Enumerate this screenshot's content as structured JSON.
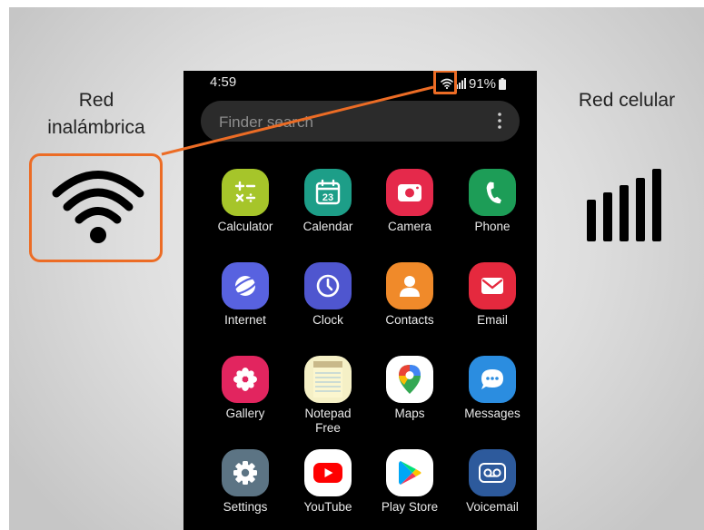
{
  "labels": {
    "wireless": "Red inalámbrica",
    "cellular": "Red celular"
  },
  "status": {
    "time": "4:59",
    "battery": "91%"
  },
  "search": {
    "placeholder": "Finder search"
  },
  "apps": [
    {
      "label": "Calculator",
      "icon": "calculator-icon"
    },
    {
      "label": "Calendar",
      "icon": "calendar-icon",
      "badge": "23"
    },
    {
      "label": "Camera",
      "icon": "camera-icon"
    },
    {
      "label": "Phone",
      "icon": "phone-icon"
    },
    {
      "label": "Internet",
      "icon": "internet-icon"
    },
    {
      "label": "Clock",
      "icon": "clock-icon"
    },
    {
      "label": "Contacts",
      "icon": "contacts-icon"
    },
    {
      "label": "Email",
      "icon": "email-icon"
    },
    {
      "label": "Gallery",
      "icon": "gallery-icon"
    },
    {
      "label": "Notepad Free",
      "icon": "notepad-icon"
    },
    {
      "label": "Maps",
      "icon": "maps-icon"
    },
    {
      "label": "Messages",
      "icon": "messages-icon"
    },
    {
      "label": "Settings",
      "icon": "settings-icon"
    },
    {
      "label": "YouTube",
      "icon": "youtube-icon"
    },
    {
      "label": "Play Store",
      "icon": "play-store-icon"
    },
    {
      "label": "Voicemail",
      "icon": "voicemail-icon"
    }
  ],
  "colors": {
    "highlight": "#ec6c25",
    "phone_bg": "#000000"
  }
}
